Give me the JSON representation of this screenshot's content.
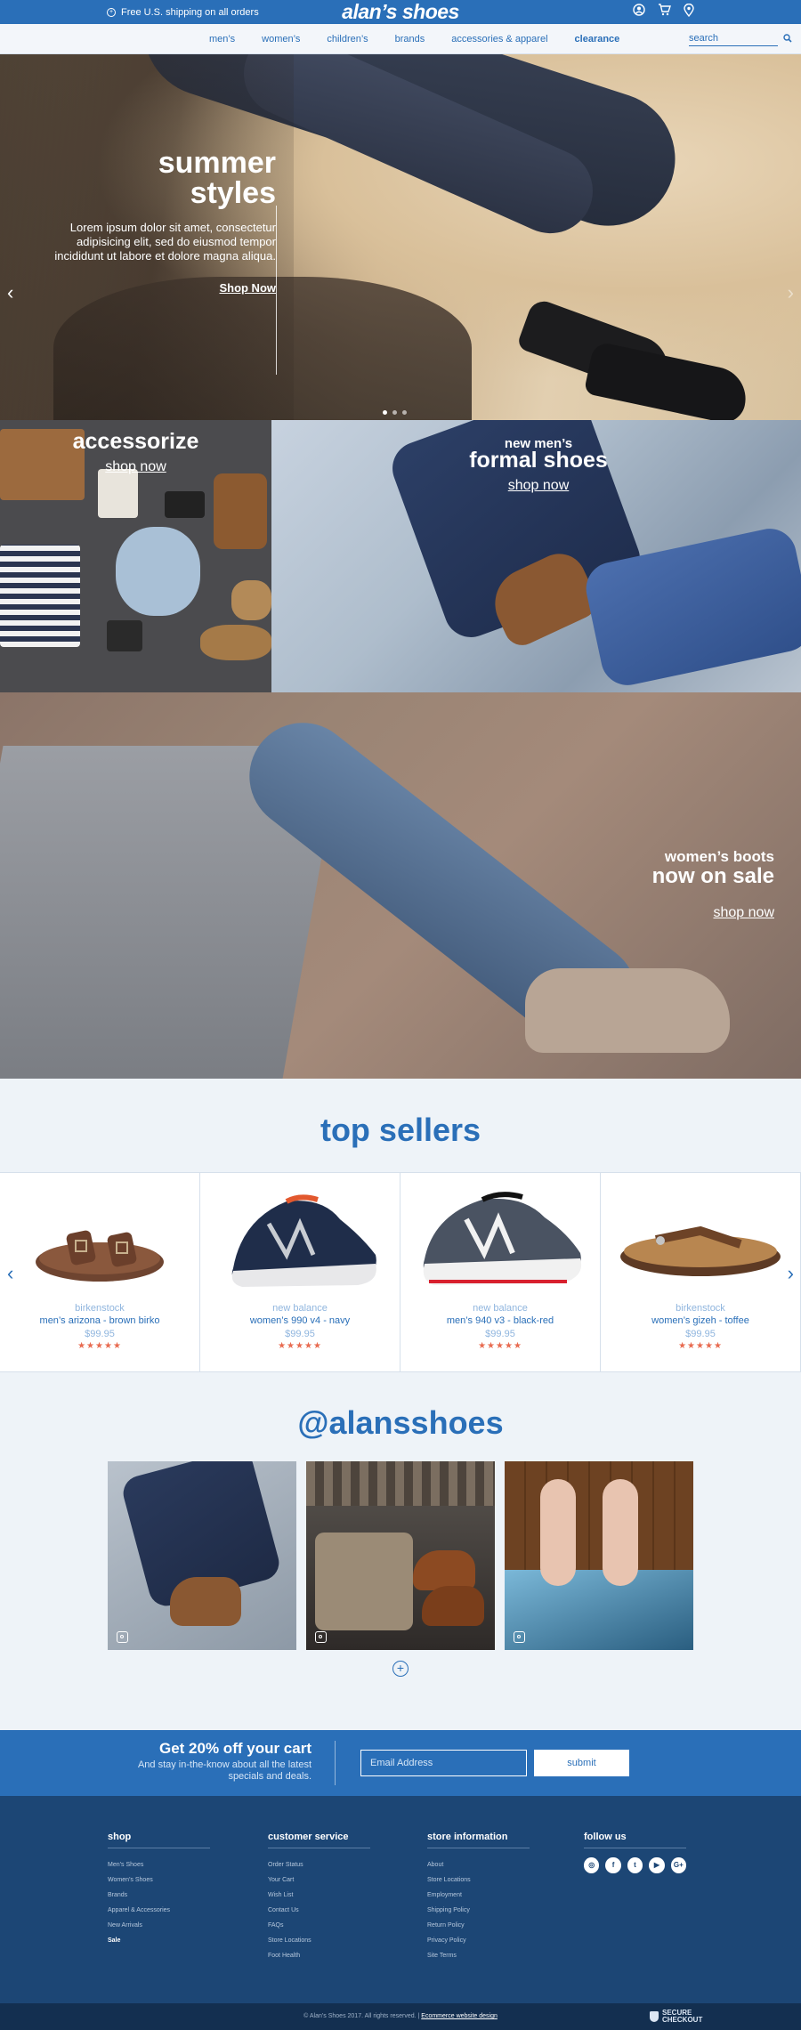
{
  "topbar": {
    "shipping_text": "Free U.S. shipping on all orders",
    "logo": "alan’s shoes"
  },
  "nav": {
    "links": [
      "men’s",
      "women’s",
      "children’s",
      "brands",
      "accessories & apparel",
      "clearance"
    ],
    "search_placeholder": "search"
  },
  "hero": {
    "title": "summer\nstyles",
    "body": "Lorem ipsum dolor sit amet, consectetur adipisicing elit, sed do eiusmod tempor incididunt ut labore et dolore magna aliqua.",
    "cta": "Shop Now"
  },
  "promos": [
    {
      "title": "accessorize",
      "cta": "shop now"
    },
    {
      "subtitle": "new men’s",
      "title": "formal shoes",
      "cta": "shop now"
    }
  ],
  "banner": {
    "subtitle": "women’s boots",
    "title": "now on sale",
    "cta": "shop now"
  },
  "top_sellers": {
    "heading": "top sellers",
    "products": [
      {
        "brand": "birkenstock",
        "name": "men’s arizona - brown birko",
        "price": "$99.95",
        "rating": "★★★★★"
      },
      {
        "brand": "new balance",
        "name": "women’s 990 v4 - navy",
        "price": "$99.95",
        "rating": "★★★★★"
      },
      {
        "brand": "new balance",
        "name": "men’s 940 v3 - black-red",
        "price": "$99.95",
        "rating": "★★★★★"
      },
      {
        "brand": "birkenstock",
        "name": "women’s gizeh - toffee",
        "price": "$99.95",
        "rating": "★★★★★"
      }
    ]
  },
  "instagram": {
    "heading": "@alansshoes"
  },
  "signup": {
    "title": "Get 20% off your cart",
    "subtitle": "And stay in-the-know about all the latest specials and deals.",
    "email_placeholder": "Email Address",
    "submit": "submit"
  },
  "footer": {
    "shop": {
      "title": "shop",
      "items": [
        "Men’s Shoes",
        "Women’s Shoes",
        "Brands",
        "Apparel & Accessories",
        "New Arrivals",
        "Sale"
      ]
    },
    "customer_service": {
      "title": "customer service",
      "items": [
        "Order Status",
        "Your Cart",
        "Wish List",
        "Contact Us",
        "FAQs",
        "Store Locations",
        "Foot Health"
      ]
    },
    "store_information": {
      "title": "store information",
      "items": [
        "About",
        "Store Locations",
        "Employment",
        "Shipping Policy",
        "Return Policy",
        "Privacy Policy",
        "Site Terms"
      ]
    },
    "follow_us": {
      "title": "follow us"
    }
  },
  "bottom": {
    "copyright": "© Alan’s Shoes 2017. All rights reserved.  |",
    "link": "Ecommerce website design",
    "secure_line1": "SECURE",
    "secure_line2": "CHECKOUT"
  },
  "colors": {
    "brand_blue": "#2a6fb8",
    "footer_navy": "#1c4675",
    "star_color": "#e86b50"
  }
}
